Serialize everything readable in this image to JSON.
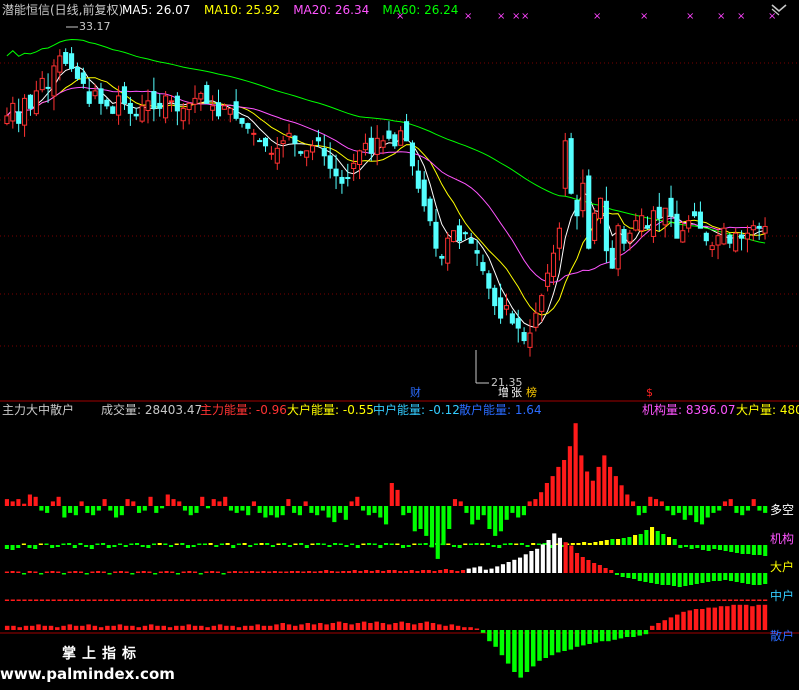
{
  "header": {
    "title": "潜能恒信(日线,前复权)",
    "indicators": [
      {
        "label": "MA5:",
        "value": "26.07",
        "color": "#ffffff"
      },
      {
        "label": "MA10:",
        "value": "25.92",
        "color": "#ffff00"
      },
      {
        "label": "MA20:",
        "value": "26.34",
        "color": "#ff55ff"
      },
      {
        "label": "MA60:",
        "value": "26.24",
        "color": "#00ff00"
      }
    ]
  },
  "price_annotations": {
    "high_label": "33.17",
    "low_label": "21.35",
    "markers": [
      {
        "text": "财",
        "color": "#2a6bff"
      },
      {
        "text": "增",
        "color": "#ffffff"
      },
      {
        "text": "张",
        "color": "#ffffff"
      },
      {
        "text": "榜",
        "color": "#ffcc00"
      },
      {
        "text": "$",
        "color": "#ff2222"
      }
    ]
  },
  "lower_panel": {
    "title": "主力大中散户",
    "readouts": [
      {
        "label": "成交量:",
        "value": "28403.47",
        "color": "#c8c8c8"
      },
      {
        "label": "主力能量:",
        "value": "-0.96",
        "color": "#ff3333"
      },
      {
        "label": "大户能量:",
        "value": "-0.55",
        "color": "#ffff00"
      },
      {
        "label": "中户能量:",
        "value": "-0.12",
        "color": "#33ccff"
      },
      {
        "label": "散户能量:",
        "value": "1.64",
        "color": "#2a6bff"
      },
      {
        "label": "机构量:",
        "value": "8396.07",
        "color": "#ff55ff"
      },
      {
        "label": "大户量:",
        "value": "480",
        "color": "#ffff00"
      }
    ],
    "row_labels": [
      {
        "text": "多空",
        "color": "#ffffff"
      },
      {
        "text": "机构",
        "color": "#ff55ff"
      },
      {
        "text": "大户",
        "color": "#ffff00"
      },
      {
        "text": "中户",
        "color": "#33ccff"
      },
      {
        "text": "散户",
        "color": "#2a6bff"
      }
    ]
  },
  "watermark": {
    "line1": "掌上指标",
    "line2": "www.palmindex.com"
  },
  "colors": {
    "up": "#ff3232",
    "down": "#54ffff",
    "bar_pos": "#ff1a1a",
    "bar_neg": "#00ff00",
    "bar_yellow": "#ffff00",
    "bar_white": "#ffffff",
    "grid": "#7a0000"
  },
  "chart_data": [
    {
      "type": "candlestick",
      "title": "潜能恒信(日线,前复权)",
      "ylim": [
        20,
        34.5
      ],
      "high": 33.17,
      "low": 21.35,
      "close_last": 26.07,
      "moving_averages": [
        {
          "name": "MA5",
          "last": 26.07
        },
        {
          "name": "MA10",
          "last": 25.92
        },
        {
          "name": "MA20",
          "last": 26.34
        },
        {
          "name": "MA60",
          "last": 26.24
        }
      ],
      "closes": [
        30.5,
        31.0,
        30.2,
        31.2,
        30.8,
        31.5,
        32.0,
        31.6,
        32.5,
        32.9,
        32.6,
        32.4,
        32.0,
        31.8,
        31.0,
        31.5,
        31.0,
        30.9,
        30.6,
        31.3,
        31.0,
        30.6,
        30.5,
        30.9,
        31.1,
        30.8,
        30.8,
        31.3,
        31.1,
        30.7,
        30.8,
        31.0,
        31.2,
        31.4,
        31.0,
        30.9,
        30.5,
        30.9,
        30.8,
        30.4,
        30.2,
        30.0,
        29.8,
        29.5,
        29.3,
        29.0,
        29.2,
        29.5,
        29.8,
        29.4,
        29.0,
        29.1,
        29.3,
        29.5,
        28.9,
        28.4,
        28.1,
        27.8,
        28.0,
        28.6,
        29.1,
        29.4,
        29.0,
        29.6,
        29.5,
        29.6,
        29.3,
        29.9,
        29.5,
        28.5,
        27.6,
        26.9,
        26.3,
        25.2,
        24.8,
        25.6,
        25.9,
        25.5,
        25.8,
        25.4,
        25.0,
        24.3,
        23.6,
        22.9,
        22.4,
        22.9,
        22.2,
        22.0,
        21.5,
        21.8,
        22.6,
        23.3,
        24.2,
        25.0,
        26.0,
        29.5,
        27.4,
        26.5,
        27.8,
        25.2,
        26.6,
        27.2,
        25.1,
        24.4,
        26.1,
        25.4,
        25.8,
        26.3,
        26.5,
        26.0,
        26.7,
        26.4,
        26.8,
        26.5,
        25.6,
        25.9,
        26.3,
        26.5,
        26.0,
        25.5,
        25.3,
        25.7,
        26.0,
        25.4,
        25.8,
        25.6,
        25.8,
        26.1,
        26.0,
        26.07
      ],
      "xlabel": "",
      "ylabel": ""
    },
    {
      "type": "bar",
      "title": "主力大中散户",
      "series": [
        {
          "name": "多空",
          "values": [
            3,
            2,
            3,
            1,
            5,
            4,
            -2,
            -3,
            2,
            4,
            -5,
            -3,
            -4,
            2,
            -3,
            -4,
            -2,
            3,
            -2,
            -5,
            -4,
            3,
            2,
            -3,
            -2,
            4,
            -3,
            -1,
            5,
            3,
            2,
            -2,
            -4,
            -3,
            4,
            -1,
            3,
            2,
            4,
            -2,
            -3,
            -2,
            -4,
            2,
            -3,
            -5,
            -4,
            -5,
            -4,
            3,
            -3,
            -4,
            2,
            -3,
            -4,
            -2,
            -5,
            -7,
            -3,
            -6,
            2,
            4,
            -2,
            -4,
            -3,
            -5,
            -8,
            10,
            7,
            -4,
            -3,
            -11,
            -10,
            -13,
            -18,
            -23,
            -17,
            -10,
            3,
            2,
            -3,
            -8,
            -6,
            -4,
            -10,
            -13,
            -11,
            -6,
            -3,
            -5,
            -4,
            2,
            3,
            6,
            10,
            13,
            17,
            20,
            26,
            36,
            22,
            15,
            11,
            17,
            22,
            17,
            13,
            9,
            5,
            2,
            -4,
            -3,
            4,
            3,
            2,
            -2,
            -4,
            -3,
            -6,
            -4,
            -7,
            -8,
            -5,
            -3,
            -2,
            2,
            3,
            -3,
            -4,
            -2,
            3,
            -2,
            -3
          ]
        },
        {
          "name": "机构",
          "values": [
            -4,
            -5,
            -3,
            1,
            -3,
            -4,
            1,
            1,
            -3,
            -2,
            1,
            2,
            -3,
            2,
            -2,
            -4,
            1,
            2,
            -3,
            -2,
            1,
            -2,
            1,
            2,
            -2,
            -3,
            1,
            2,
            1,
            -2,
            1,
            2,
            -3,
            -2,
            1,
            1,
            2,
            -2,
            1,
            2,
            -3,
            1,
            2,
            -2,
            1,
            2,
            2,
            -2,
            1,
            2,
            -2,
            1,
            2,
            -3,
            1,
            2,
            1,
            -2,
            2,
            1,
            -2,
            1,
            -3,
            1,
            2,
            1,
            -3,
            2,
            1,
            1,
            -3,
            -2,
            1,
            1,
            2,
            -2,
            2,
            1,
            1,
            -2,
            -3,
            1,
            1,
            2,
            1,
            2,
            -2,
            -3,
            1,
            2,
            1,
            2,
            -2,
            2,
            1,
            2,
            -3,
            1,
            -2,
            1,
            2,
            2,
            3,
            2,
            3,
            4,
            5,
            6,
            6,
            7,
            8,
            10,
            11,
            15,
            18,
            14,
            11,
            8,
            6,
            -3,
            -2,
            -4,
            -3,
            -5,
            -6,
            -4,
            -5,
            -6,
            -7,
            -8,
            -9,
            -9,
            -10,
            -10,
            -11
          ]
        },
        {
          "name": "大户",
          "values": [
            1,
            2,
            1,
            -1,
            2,
            1,
            -1,
            1,
            2,
            1,
            -1,
            1,
            2,
            1,
            -1,
            1,
            2,
            1,
            -1,
            1,
            2,
            1,
            -1,
            1,
            2,
            1,
            -1,
            1,
            2,
            1,
            -1,
            1,
            2,
            1,
            -1,
            1,
            2,
            1,
            -1,
            1,
            2,
            1,
            1,
            2,
            1,
            2,
            1,
            2,
            1,
            1,
            2,
            2,
            1,
            2,
            1,
            2,
            3,
            2,
            1,
            2,
            2,
            3,
            2,
            3,
            2,
            3,
            2,
            3,
            3,
            2,
            2,
            3,
            2,
            3,
            3,
            2,
            3,
            4,
            3,
            2,
            3,
            4,
            5,
            6,
            3,
            4,
            6,
            8,
            10,
            12,
            14,
            17,
            20,
            22,
            26,
            30,
            36,
            32,
            28,
            25,
            20,
            16,
            13,
            10,
            8,
            5,
            3,
            -2,
            -4,
            -5,
            -6,
            -8,
            -9,
            -10,
            -11,
            -12,
            -12,
            -13,
            -14,
            -13,
            -12,
            -11,
            -10,
            -9,
            -8,
            -8,
            -7,
            -8,
            -9,
            -10,
            -11,
            -12,
            -12,
            -11
          ]
        },
        {
          "name": "中户",
          "values": [
            1,
            1,
            1,
            1,
            1,
            1,
            1,
            1,
            1,
            1,
            1,
            1,
            1,
            1,
            1,
            1,
            1,
            1,
            1,
            1,
            1,
            1,
            1,
            1,
            1,
            1,
            1,
            1,
            1,
            1,
            1,
            1,
            1,
            1,
            1,
            1,
            1,
            1,
            1,
            1,
            1,
            1,
            1,
            1,
            1,
            1,
            1,
            1,
            1,
            1,
            1,
            1,
            1,
            1,
            1,
            1,
            1,
            1,
            1,
            1,
            1,
            1,
            1,
            1,
            1,
            1,
            1,
            1,
            1,
            1,
            1,
            1,
            1,
            1,
            1,
            1,
            1,
            1,
            1,
            1,
            1,
            1,
            1,
            1,
            1,
            1,
            1,
            1,
            1,
            1,
            1,
            1,
            1,
            1,
            1,
            1,
            1,
            1,
            1,
            1,
            1,
            1,
            1,
            1,
            1,
            1,
            1,
            1,
            1,
            1,
            1,
            1,
            1,
            1,
            1,
            1,
            1,
            1,
            1,
            1,
            1,
            1,
            1,
            1,
            1,
            1,
            1,
            1,
            1,
            1,
            1
          ]
        },
        {
          "name": "散户",
          "values": [
            3,
            3,
            2,
            3,
            3,
            4,
            3,
            3,
            2,
            3,
            4,
            3,
            3,
            4,
            3,
            2,
            3,
            3,
            4,
            3,
            3,
            2,
            3,
            4,
            3,
            3,
            2,
            3,
            3,
            4,
            3,
            3,
            2,
            3,
            4,
            3,
            3,
            2,
            3,
            3,
            4,
            3,
            3,
            4,
            5,
            4,
            3,
            4,
            5,
            4,
            5,
            4,
            5,
            6,
            5,
            4,
            5,
            6,
            5,
            6,
            5,
            4,
            5,
            6,
            5,
            4,
            5,
            6,
            5,
            4,
            3,
            4,
            3,
            2,
            2,
            1,
            -2,
            -8,
            -12,
            -18,
            -24,
            -30,
            -34,
            -30,
            -26,
            -22,
            -20,
            -18,
            -16,
            -15,
            -14,
            -12,
            -11,
            -10,
            -9,
            -8,
            -8,
            -7,
            -6,
            -5,
            -5,
            -4,
            -3,
            3,
            5,
            7,
            9,
            11,
            13,
            14,
            15,
            15,
            16,
            16,
            17,
            17,
            18,
            18,
            18,
            17,
            18,
            18
          ]
        }
      ],
      "xlabel": "",
      "ylabel": ""
    }
  ]
}
